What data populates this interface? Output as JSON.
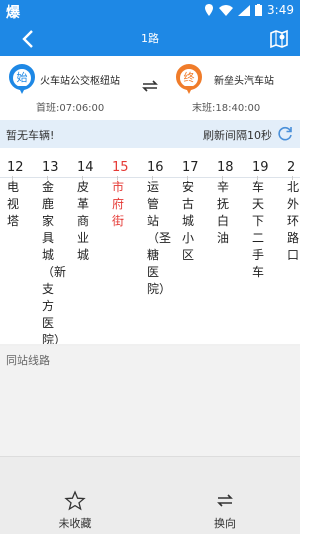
{
  "status_bar": {
    "app_glyph": "爆",
    "time": "3:49"
  },
  "header": {
    "title": "1路"
  },
  "route": {
    "start": {
      "badge": "始",
      "name": "火车站公交枢纽站",
      "first_bus": "首班:07:06:00"
    },
    "end": {
      "badge": "终",
      "name": "新垒头汽车站",
      "last_bus": "末班:18:40:00"
    }
  },
  "notice": {
    "left": "暂无车辆!",
    "right": "刷新间隔10秒"
  },
  "stations": [
    {
      "num": "12",
      "name": "电视塔"
    },
    {
      "num": "13",
      "name": "金鹿家具城（新支方医院）"
    },
    {
      "num": "14",
      "name": "皮革商业城"
    },
    {
      "num": "15",
      "name": "市府街",
      "active": true
    },
    {
      "num": "16",
      "name": "运管站（圣糖医院）"
    },
    {
      "num": "17",
      "name": "安古城小区"
    },
    {
      "num": "18",
      "name": "辛抚白油"
    },
    {
      "num": "19",
      "name": "车天下二手车"
    },
    {
      "num": "2",
      "name": "北外环路口"
    }
  ],
  "same_lines": {
    "label": "同站线路"
  },
  "bottom": {
    "favorite": "未收藏",
    "reverse": "换向"
  },
  "colors": {
    "primary": "#1e88e5",
    "start_pin": "#1e88e5",
    "end_pin": "#f07c2a",
    "active": "#e53935"
  }
}
